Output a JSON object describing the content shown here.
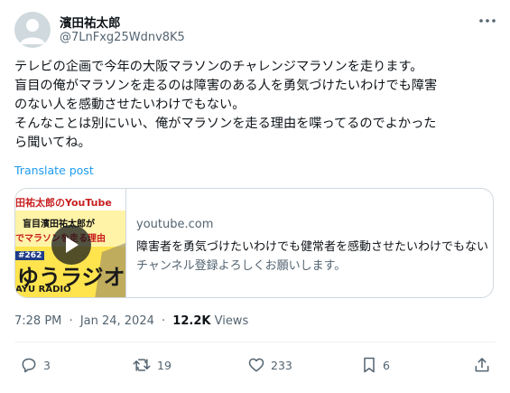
{
  "user": {
    "display_name": "濱田祐太郎",
    "handle": "@7LnFxg25Wdnv8K5"
  },
  "tweet": {
    "text": "テレビの企画で今年の大阪マラソンのチャレンジマラソンを走ります。\n盲目の俺がマラソンを走るのは障害のある人を勇気づけたいわけでも障害\nのない人を感動させたいわけでもない。\nそんなことは別にいい、俺がマラソンを走る理由を喋ってるのでよかった\nら聞いてね。",
    "translate_label": "Translate post"
  },
  "card": {
    "domain": "youtube.com",
    "title": "障害者を勇気づけたいわけでも健常者を感動させたいわけでもない",
    "description": "チャンネル登録よろしくお願いします。",
    "thumbnail": {
      "line1": "田祐太郎のYouTube",
      "line2": "盲目濱田祐太郎が",
      "line3": "でマラソンを走る理由",
      "episode": "#262",
      "logo": "ゆうラジオ",
      "sub": "AYU RADIO"
    }
  },
  "meta": {
    "time": "7:28 PM",
    "separator": "·",
    "date": "Jan 24, 2024",
    "views_count": "12.2K",
    "views_label": "Views"
  },
  "actions": {
    "replies": "3",
    "reposts": "19",
    "likes": "233",
    "bookmarks": "6"
  },
  "icons": {
    "more": "more-horizontal-icon",
    "reply": "reply-icon",
    "repost": "repost-icon",
    "like": "heart-icon",
    "bookmark": "bookmark-icon",
    "share": "share-icon",
    "play": "play-icon"
  },
  "colors": {
    "link": "#1d9bf0",
    "secondary_text": "#536471",
    "border": "#cfd9de"
  }
}
